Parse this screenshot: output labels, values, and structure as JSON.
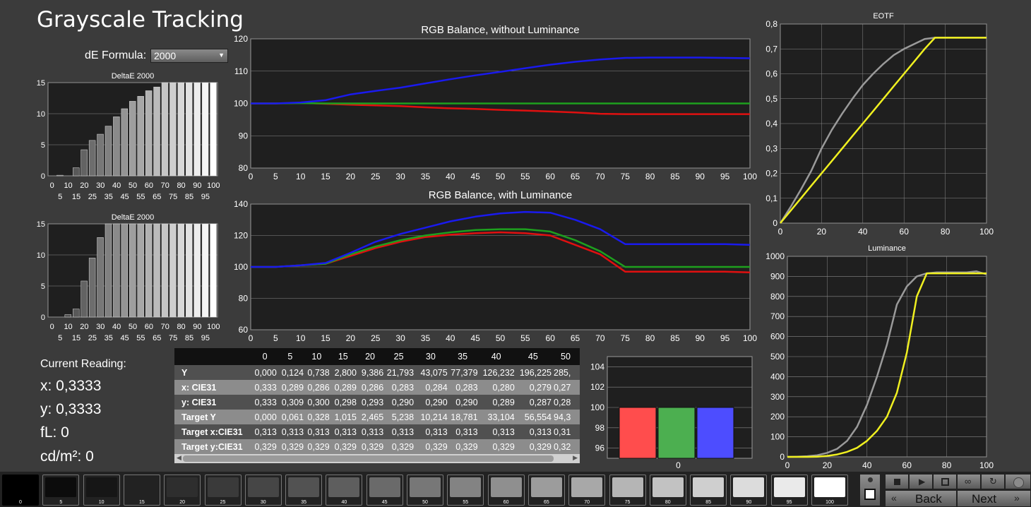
{
  "title": "Grayscale Tracking",
  "de_formula": {
    "label": "dE Formula:",
    "value": "2000"
  },
  "current_reading": {
    "title": "Current Reading:",
    "x": "x: 0,3333",
    "y": "y: 0,3333",
    "fl": "fL: 0",
    "cdm2": "cd/m²: 0"
  },
  "colors": {
    "red": "#e01010",
    "green": "#1ea01e",
    "blue": "#1a1aee",
    "gray": "#9a9a9a",
    "yellow": "#f0f020",
    "plot_bg": "#1f1f1f",
    "grid": "#8a8a8a"
  },
  "chart_data": [
    {
      "id": "deltae-top",
      "type": "bar",
      "title": "DeltaE 2000",
      "categories": [
        "0",
        "5",
        "10",
        "15",
        "20",
        "25",
        "30",
        "35",
        "40",
        "45",
        "50",
        "55",
        "60",
        "65",
        "70",
        "75",
        "80",
        "85",
        "90",
        "95",
        "100"
      ],
      "values": [
        0,
        0.1,
        0,
        1.3,
        4.2,
        5.7,
        6.7,
        8.0,
        9.5,
        10.8,
        12.0,
        12.8,
        13.7,
        14.3,
        15,
        15,
        15,
        15,
        15,
        15,
        15
      ],
      "ylim": [
        0,
        15
      ],
      "yticks": [
        "0",
        "5",
        "10",
        "15"
      ],
      "xticks_top": [
        "0",
        "10",
        "20",
        "30",
        "40",
        "50",
        "60",
        "70",
        "80",
        "90",
        "100"
      ],
      "xticks_bottom": [
        "5",
        "15",
        "25",
        "35",
        "45",
        "55",
        "65",
        "75",
        "85",
        "95"
      ]
    },
    {
      "id": "deltae-bottom",
      "type": "bar",
      "title": "DeltaE 2000",
      "categories": [
        "0",
        "5",
        "10",
        "15",
        "20",
        "25",
        "30",
        "35",
        "40",
        "45",
        "50",
        "55",
        "60",
        "65",
        "70",
        "75",
        "80",
        "85",
        "90",
        "95",
        "100"
      ],
      "values": [
        0,
        0,
        0.4,
        1.3,
        5.8,
        9.5,
        12.8,
        15,
        15,
        15,
        15,
        15,
        15,
        15,
        15,
        15,
        15,
        15,
        15,
        15,
        15
      ],
      "ylim": [
        0,
        15
      ],
      "yticks": [
        "0",
        "5",
        "10",
        "15"
      ],
      "xticks_top": [
        "0",
        "10",
        "20",
        "30",
        "40",
        "50",
        "60",
        "70",
        "80",
        "90",
        "100"
      ],
      "xticks_bottom": [
        "5",
        "15",
        "25",
        "35",
        "45",
        "55",
        "65",
        "75",
        "85",
        "95"
      ]
    },
    {
      "id": "rgb-no-lum",
      "type": "line",
      "title": "RGB Balance, without Luminance",
      "x": [
        0,
        5,
        10,
        15,
        20,
        25,
        30,
        35,
        40,
        45,
        50,
        55,
        60,
        65,
        70,
        75,
        80,
        85,
        90,
        95,
        100
      ],
      "xticks": [
        "0",
        "5",
        "10",
        "15",
        "20",
        "25",
        "30",
        "35",
        "40",
        "45",
        "50",
        "55",
        "60",
        "65",
        "70",
        "75",
        "80",
        "85",
        "90",
        "95",
        "100"
      ],
      "ylim": [
        80,
        120
      ],
      "yticks": [
        "80",
        "90",
        "100",
        "110",
        "120"
      ],
      "series": [
        {
          "color": "red",
          "values": [
            100,
            100,
            100.2,
            99.9,
            99.6,
            99.4,
            99.2,
            98.8,
            98.5,
            98.3,
            98.0,
            97.8,
            97.5,
            97.2,
            96.8,
            96.7,
            96.7,
            96.7,
            96.7,
            96.7,
            96.7
          ]
        },
        {
          "color": "green",
          "values": [
            100,
            100,
            100.1,
            100,
            100,
            100,
            100,
            100,
            100,
            100,
            100,
            100,
            100,
            100,
            100,
            100,
            100,
            100,
            100,
            100,
            100
          ]
        },
        {
          "color": "blue",
          "values": [
            100,
            100,
            100.3,
            101,
            102.8,
            103.9,
            104.9,
            106.2,
            107.5,
            108.7,
            109.8,
            110.9,
            112.0,
            112.9,
            113.6,
            114.1,
            114.2,
            114.2,
            114.2,
            114.1,
            114.0
          ]
        }
      ]
    },
    {
      "id": "rgb-with-lum",
      "type": "line",
      "title": "RGB Balance, with Luminance",
      "x": [
        0,
        5,
        10,
        15,
        20,
        25,
        30,
        35,
        40,
        45,
        50,
        55,
        60,
        65,
        70,
        75,
        80,
        85,
        90,
        95,
        100
      ],
      "xticks": [
        "0",
        "5",
        "10",
        "15",
        "20",
        "25",
        "30",
        "35",
        "40",
        "45",
        "50",
        "55",
        "60",
        "65",
        "70",
        "75",
        "80",
        "85",
        "90",
        "95",
        "100"
      ],
      "ylim": [
        60,
        140
      ],
      "yticks": [
        "60",
        "80",
        "100",
        "120",
        "140"
      ],
      "series": [
        {
          "color": "red",
          "values": [
            100,
            100,
            101,
            102,
            107,
            112,
            116,
            119,
            120.5,
            121.5,
            122,
            121.5,
            120,
            114,
            108,
            97,
            97,
            97,
            97,
            97,
            96.5
          ]
        },
        {
          "color": "green",
          "values": [
            100,
            100,
            101,
            102,
            108,
            113,
            117,
            120,
            122,
            123.5,
            124,
            124,
            122.5,
            117,
            110,
            100,
            100,
            100,
            100,
            100,
            100
          ]
        },
        {
          "color": "blue",
          "values": [
            100,
            100,
            101,
            102.5,
            109,
            116,
            121,
            125,
            129,
            132,
            134,
            135,
            134.5,
            130,
            124,
            114.5,
            114.5,
            114.5,
            114.5,
            114.5,
            114
          ]
        }
      ]
    },
    {
      "id": "eotf",
      "type": "line",
      "title": "EOTF",
      "x": [
        0,
        5,
        10,
        15,
        20,
        25,
        30,
        35,
        40,
        45,
        50,
        55,
        60,
        65,
        70,
        75,
        80,
        85,
        90,
        95,
        100
      ],
      "xticks": [
        "0",
        "20",
        "40",
        "60",
        "80",
        "100"
      ],
      "ylim": [
        0,
        0.8
      ],
      "yticks": [
        "0",
        "0,1",
        "0,2",
        "0,3",
        "0,4",
        "0,5",
        "0,6",
        "0,7",
        "0,8"
      ],
      "series": [
        {
          "color": "gray",
          "values": [
            0,
            0.065,
            0.135,
            0.21,
            0.3,
            0.375,
            0.44,
            0.5,
            0.555,
            0.6,
            0.64,
            0.675,
            0.7,
            0.72,
            0.74,
            0.745,
            0.745,
            0.745,
            0.745,
            0.745,
            0.745
          ]
        },
        {
          "color": "yellow",
          "values": [
            0,
            0.05,
            0.1,
            0.15,
            0.2,
            0.25,
            0.3,
            0.35,
            0.4,
            0.45,
            0.5,
            0.55,
            0.6,
            0.65,
            0.7,
            0.745,
            0.745,
            0.745,
            0.745,
            0.745,
            0.745
          ]
        }
      ]
    },
    {
      "id": "luminance",
      "type": "line",
      "title": "Luminance",
      "x": [
        0,
        5,
        10,
        15,
        20,
        25,
        30,
        35,
        40,
        45,
        50,
        55,
        60,
        65,
        70,
        75,
        80,
        85,
        90,
        95,
        100
      ],
      "xticks": [
        "0",
        "20",
        "40",
        "60",
        "80",
        "100"
      ],
      "ylim": [
        0,
        1000
      ],
      "yticks": [
        "0",
        "100",
        "200",
        "300",
        "400",
        "500",
        "600",
        "700",
        "800",
        "900",
        "1000"
      ],
      "series": [
        {
          "color": "gray",
          "values": [
            0,
            1,
            3,
            8,
            20,
            40,
            80,
            150,
            260,
            400,
            560,
            760,
            850,
            900,
            915,
            920,
            920,
            920,
            920,
            925,
            910
          ]
        },
        {
          "color": "yellow",
          "values": [
            0,
            0,
            0,
            1,
            5,
            12,
            25,
            45,
            80,
            130,
            200,
            320,
            520,
            800,
            915,
            915,
            915,
            915,
            915,
            915,
            915
          ]
        }
      ]
    },
    {
      "id": "rgb-bars",
      "type": "bar",
      "categories": [
        "0"
      ],
      "ylim": [
        95,
        105
      ],
      "yticks": [
        "96",
        "98",
        "100",
        "102",
        "104"
      ],
      "series": [
        {
          "color": "#ff4d4d",
          "values": [
            100
          ]
        },
        {
          "color": "#4caf50",
          "values": [
            100
          ]
        },
        {
          "color": "#4d4dff",
          "values": [
            100
          ]
        }
      ]
    }
  ],
  "table": {
    "columns": [
      "0",
      "5",
      "10",
      "15",
      "20",
      "25",
      "30",
      "35",
      "40",
      "45",
      "50"
    ],
    "rows": [
      {
        "label": "Y",
        "values": [
          "0,000",
          "0,124",
          "0,738",
          "2,800",
          "9,386",
          "21,793",
          "43,075",
          "77,379",
          "126,232",
          "196,225",
          "285,"
        ]
      },
      {
        "label": "x: CIE31",
        "values": [
          "0,333",
          "0,289",
          "0,286",
          "0,289",
          "0,286",
          "0,283",
          "0,284",
          "0,283",
          "0,280",
          "0,279",
          "0,27"
        ]
      },
      {
        "label": "y: CIE31",
        "values": [
          "0,333",
          "0,309",
          "0,300",
          "0,298",
          "0,293",
          "0,290",
          "0,290",
          "0,290",
          "0,289",
          "0,287",
          "0,28"
        ]
      },
      {
        "label": "Target Y",
        "values": [
          "0,000",
          "0,061",
          "0,328",
          "1,015",
          "2,465",
          "5,238",
          "10,214",
          "18,781",
          "33,104",
          "56,554",
          "94,3"
        ]
      },
      {
        "label": "Target x:CIE31",
        "values": [
          "0,313",
          "0,313",
          "0,313",
          "0,313",
          "0,313",
          "0,313",
          "0,313",
          "0,313",
          "0,313",
          "0,313",
          "0,31"
        ]
      },
      {
        "label": "Target y:CIE31",
        "values": [
          "0,329",
          "0,329",
          "0,329",
          "0,329",
          "0,329",
          "0,329",
          "0,329",
          "0,329",
          "0,329",
          "0,329",
          "0,32"
        ]
      }
    ]
  },
  "patches": [
    {
      "label": "0",
      "gray": "#000000"
    },
    {
      "label": "5",
      "gray": "#0c0c0c"
    },
    {
      "label": "10",
      "gray": "#161616"
    },
    {
      "label": "15",
      "gray": "#222222"
    },
    {
      "label": "20",
      "gray": "#2e2e2e"
    },
    {
      "label": "25",
      "gray": "#3a3a3a"
    },
    {
      "label": "30",
      "gray": "#464646"
    },
    {
      "label": "35",
      "gray": "#525252"
    },
    {
      "label": "40",
      "gray": "#5e5e5e"
    },
    {
      "label": "45",
      "gray": "#6a6a6a"
    },
    {
      "label": "50",
      "gray": "#777777"
    },
    {
      "label": "55",
      "gray": "#838383"
    },
    {
      "label": "60",
      "gray": "#8f8f8f"
    },
    {
      "label": "65",
      "gray": "#9c9c9c"
    },
    {
      "label": "70",
      "gray": "#a8a8a8"
    },
    {
      "label": "75",
      "gray": "#b5b5b5"
    },
    {
      "label": "80",
      "gray": "#c2c2c2"
    },
    {
      "label": "85",
      "gray": "#cfcfcf"
    },
    {
      "label": "90",
      "gray": "#dcdcdc"
    },
    {
      "label": "95",
      "gray": "#eaeaea"
    },
    {
      "label": "100",
      "gray": "#ffffff"
    }
  ],
  "nav": {
    "back": "Back",
    "next": "Next"
  },
  "icons": [
    "stop-icon",
    "play-icon",
    "save-icon",
    "loop-icon",
    "refresh-icon",
    "record-icon",
    "target-icon",
    "scroll-left-icon",
    "scroll-right-icon"
  ]
}
